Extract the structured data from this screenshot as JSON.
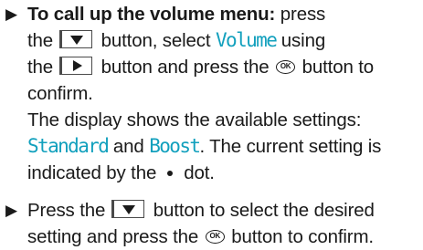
{
  "instructions": {
    "bullet_symbol": "▶",
    "step1": {
      "heading": "To call up the volume menu:",
      "t1": " press",
      "t2": "the",
      "t3": " button, select ",
      "volume_display": "Volume",
      "t4": " using",
      "t5": "the",
      "t6": " button and press the",
      "t7": " button to",
      "t8": "confirm.",
      "t9": "The display shows the available settings:",
      "standard_display": "Standard",
      "t10": " and ",
      "boost_display": "Boost",
      "t11": ". The current setting is",
      "t12": "indicated by the",
      "t13": "dot."
    },
    "step2": {
      "t1": "Press the",
      "t2": " button to select the desired",
      "t3": "setting and press the",
      "t4": " button to confirm."
    },
    "ok_label": "OK",
    "icons": {
      "down": "down-arrow-key-icon",
      "right": "right-arrow-key-icon",
      "ok": "ok-button-icon",
      "dot": "selection-dot-icon"
    },
    "colors": {
      "display_text": "#12a0bd",
      "body_text": "#1a1a1a"
    }
  }
}
